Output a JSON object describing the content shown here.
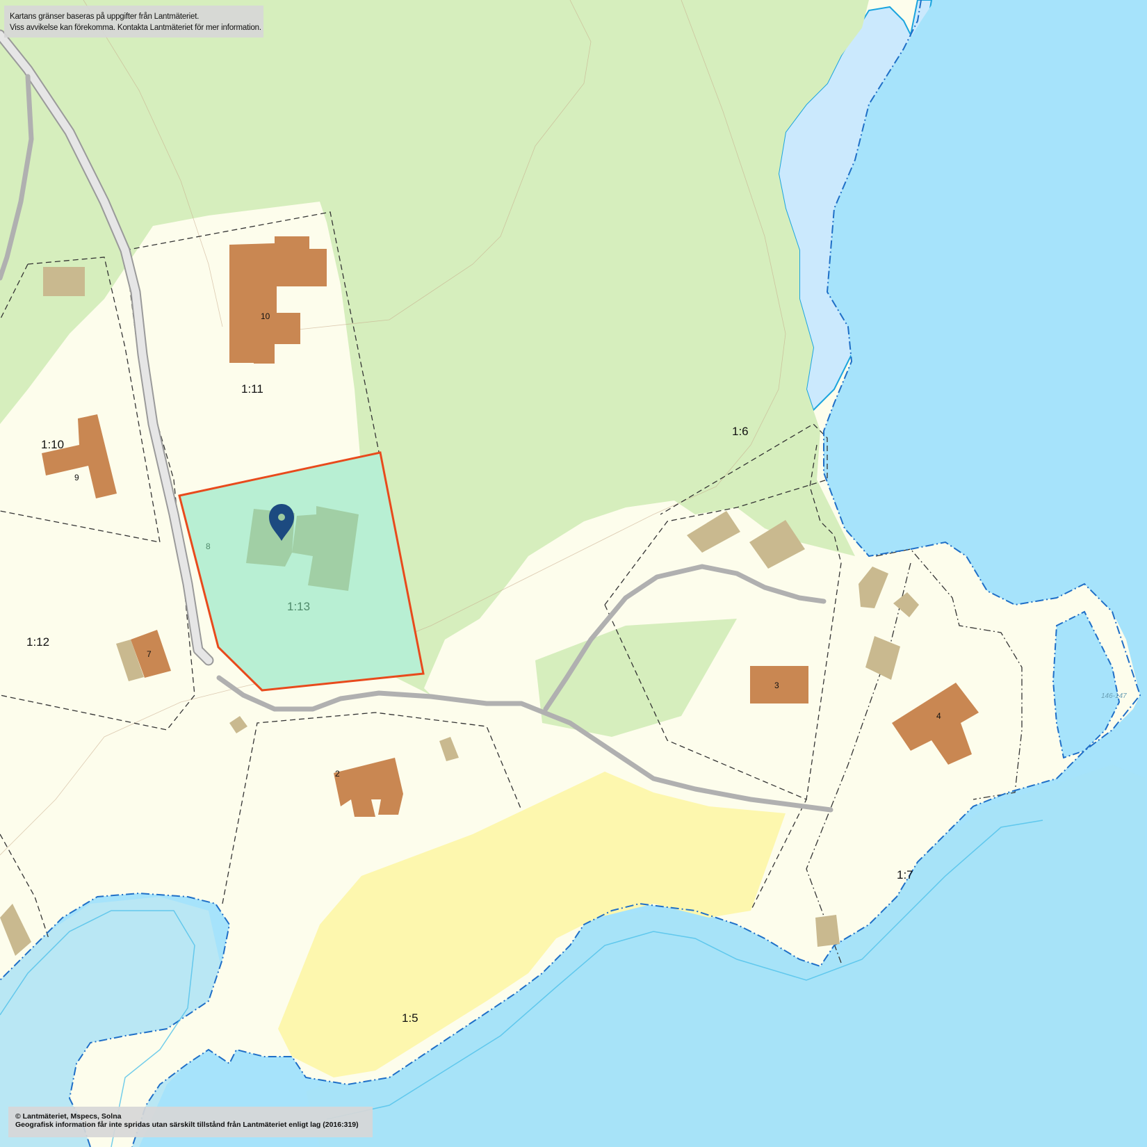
{
  "map": {
    "notice_top": {
      "line1": "Kartans gränser baseras på uppgifter från Lantmäteriet.",
      "line2": "Viss avvikelse kan förekomma. Kontakta Lantmäteriet för mer information."
    },
    "notice_bottom": {
      "line1": "© Lantmäteriet, Mspecs, Solna",
      "line2": "Geografisk information får inte spridas utan särskilt tillstånd från Lantmäteriet enligt lag (2016:319)"
    },
    "parcels": {
      "p1_11": "1:11",
      "p1_10": "1:10",
      "p1_12": "1:12",
      "p1_13": "1:13",
      "p1_6": "1:6",
      "p1_7": "1:7",
      "p1_5": "1:5"
    },
    "buildings": {
      "b10": "10",
      "b9": "9",
      "b7": "7",
      "b8": "8",
      "b2": "2",
      "b3": "3",
      "b4": "4"
    },
    "elevation": "146-147",
    "colors": {
      "water": "#a6e3fb",
      "land": "#fdfdec",
      "forest": "#d6eebd",
      "selected_parcel": "#b8efd3",
      "selection_border": "#e84a1c",
      "building": "#c98752",
      "outbuilding": "#c9b98f",
      "road": "#b0b0b0",
      "marker": "#1c4a80",
      "field": "#fdf7ae"
    },
    "icons": {
      "marker": "map-pin-icon"
    }
  }
}
